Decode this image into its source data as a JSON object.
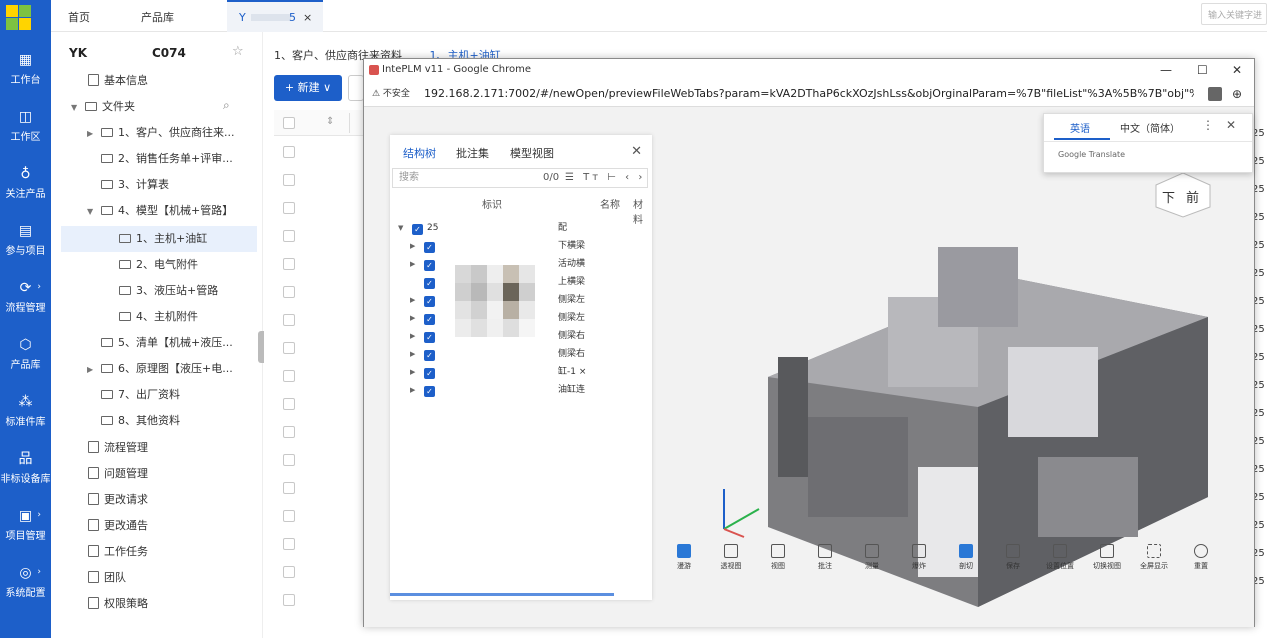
{
  "top_tabs": {
    "home": "首页",
    "products": "产品库",
    "active_tab": "Y",
    "active_tab_suffix": "5",
    "close": "×"
  },
  "search": {
    "placeholder": "输入关键字进"
  },
  "nav": {
    "items": [
      {
        "label": "工作台",
        "icon": "calendar-icon"
      },
      {
        "label": "工作区",
        "icon": "workspace-icon"
      },
      {
        "label": "关注产品",
        "icon": "follow-icon"
      },
      {
        "label": "参与项目",
        "icon": "project-icon"
      },
      {
        "label": "流程管理",
        "icon": "flow-icon",
        "arrow": "›"
      },
      {
        "label": "产品库",
        "icon": "cube-icon"
      },
      {
        "label": "标准件库",
        "icon": "parts-icon"
      },
      {
        "label": "非标设备库",
        "icon": "equipment-icon"
      },
      {
        "label": "项目管理",
        "icon": "manage-icon",
        "arrow": "›"
      },
      {
        "label": "系统配置",
        "icon": "settings-icon",
        "arrow": "›"
      }
    ]
  },
  "tree": {
    "project_title": "YK",
    "project_code": "C074",
    "star": "☆",
    "nodes": [
      {
        "label": "基本信息",
        "type": "doc"
      },
      {
        "label": "文件夹",
        "type": "folder",
        "caret": "▼"
      },
      {
        "label": "1、客户、供应商往来...",
        "type": "folder",
        "caret": "▶"
      },
      {
        "label": "2、销售任务单+评审...",
        "type": "folder"
      },
      {
        "label": "3、计算表",
        "type": "folder"
      },
      {
        "label": "4、模型【机械+管路】",
        "type": "folder",
        "caret": "▼"
      },
      {
        "label": "1、主机+油缸",
        "type": "folder"
      },
      {
        "label": "2、电气附件",
        "type": "folder"
      },
      {
        "label": "3、液压站+管路",
        "type": "folder"
      },
      {
        "label": "4、主机附件",
        "type": "folder"
      },
      {
        "label": "5、清单【机械+液压...",
        "type": "folder"
      },
      {
        "label": "6、原理图【液压+电...",
        "type": "folder",
        "caret": "▶"
      },
      {
        "label": "7、出厂资料",
        "type": "folder"
      },
      {
        "label": "8、其他资料",
        "type": "folder"
      },
      {
        "label": "流程管理",
        "type": "doc"
      },
      {
        "label": "问题管理",
        "type": "doc"
      },
      {
        "label": "更改请求",
        "type": "doc"
      },
      {
        "label": "更改通告",
        "type": "doc"
      },
      {
        "label": "工作任务",
        "type": "doc"
      },
      {
        "label": "团队",
        "type": "doc"
      },
      {
        "label": "权限策略",
        "type": "doc"
      }
    ]
  },
  "main": {
    "breadcrumb_1": "1、客户、供应商往来资料",
    "breadcrumb_2": "1、主机+油缸",
    "new_button": "+ 新建 ∨",
    "right_col": [
      "25",
      "25",
      "25",
      "25",
      "25",
      "25",
      "25",
      "25",
      "25",
      "25",
      "25",
      "25",
      "25",
      "25",
      "25",
      "25",
      "25"
    ]
  },
  "popup": {
    "title": "IntePLM v11 - Google Chrome",
    "minimize": "—",
    "maximize": "☐",
    "close": "✕",
    "insecure": "⚠ 不安全",
    "url": "192.168.2.171:7002/#/newOpen/previewFileWebTabs?param=kVA2DThaP6ckXOzJshLss&objOrginalParam=%7B\"fileList\"%3A%5B%7B\"obj\"%3A%7B\"fileH...",
    "struct_tabs": [
      "结构树",
      "批注集",
      "模型视图"
    ],
    "struct_close": "✕",
    "search_placeholder": "搜索",
    "count": "0/0",
    "tools": "☰ Tт ⊢ ‹ ›",
    "col_headers": [
      "标识",
      "名称",
      "材料"
    ],
    "rows": [
      {
        "tri": "▼",
        "label": "25",
        "suffix": "配"
      },
      {
        "tri": "▶",
        "suffix": "下横梁"
      },
      {
        "tri": "▶",
        "suffix": "活动横"
      },
      {
        "tri": "",
        "suffix": "上横梁"
      },
      {
        "tri": "▶",
        "suffix": "侧梁左"
      },
      {
        "tri": "▶",
        "suffix": "侧梁左"
      },
      {
        "tri": "▶",
        "suffix": "侧梁右"
      },
      {
        "tri": "▶",
        "suffix": "侧梁右"
      },
      {
        "tri": "▶",
        "suffix": "缸-1 ×"
      },
      {
        "tri": "▶",
        "suffix": "油缸连"
      }
    ],
    "cube_label": "下",
    "cube_label_2": "前",
    "toolbar": [
      "漫游",
      "透视图",
      "视图",
      "批注",
      "测量",
      "爆炸",
      "剖切",
      "保存",
      "设置位置",
      "切换视图",
      "全屏显示",
      "重置"
    ]
  },
  "translate": {
    "english": "英语",
    "chinese": "中文（简体）",
    "more": "⋮",
    "close": "✕",
    "brand": "Google Translate"
  },
  "colors": {
    "nav_bg": "#1d5fc9",
    "accent": "#1d5fc9"
  }
}
